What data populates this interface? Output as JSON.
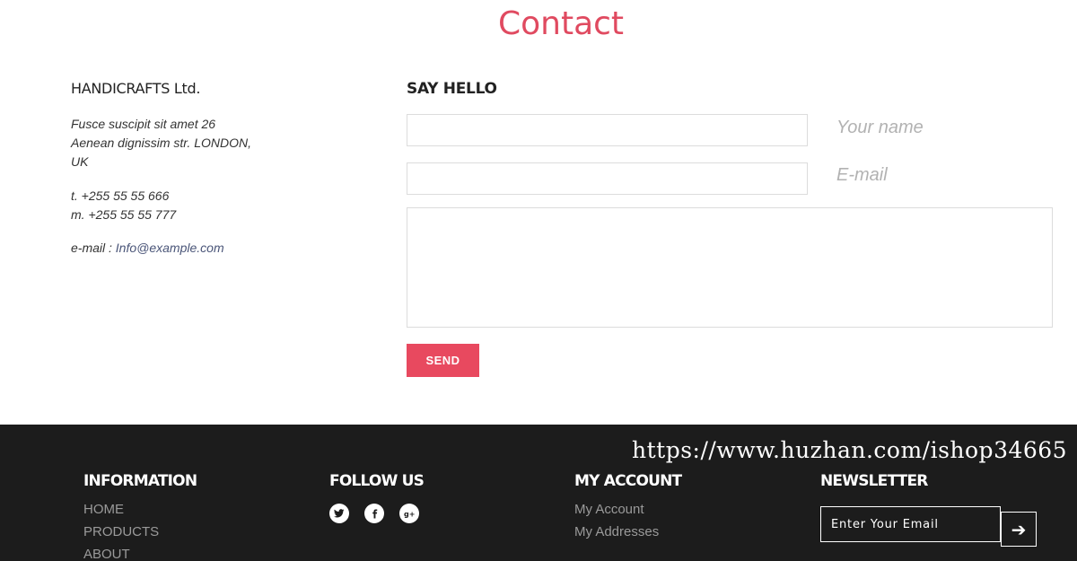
{
  "page_title": "Contact",
  "company": {
    "name": "HANDICRAFTS Ltd.",
    "address_line1": "Fusce suscipit sit amet 26",
    "address_line2": "Aenean dignissim str. LONDON,",
    "address_line3": "UK",
    "phone": "t. +255 55 55 666",
    "mobile": "m. +255 55 55 777",
    "email_label": "e-mail :",
    "email": "Info@example.com"
  },
  "form": {
    "heading": "SAY HELLO",
    "name_label": "Your name",
    "email_label": "E-mail",
    "name_value": "",
    "email_value": "",
    "message_value": "",
    "send_label": "SEND"
  },
  "footer": {
    "watermark": "https://www.huzhan.com/ishop34665",
    "information": {
      "heading": "INFORMATION",
      "links": [
        "HOME",
        "PRODUCTS",
        "ABOUT"
      ]
    },
    "follow": {
      "heading": "FOLLOW US",
      "icons": [
        "twitter-icon",
        "facebook-icon",
        "google-plus-icon"
      ]
    },
    "account": {
      "heading": "MY ACCOUNT",
      "links": [
        "My Account",
        "My Addresses"
      ]
    },
    "newsletter": {
      "heading": "NEWSLETTER",
      "placeholder": "Enter Your Email",
      "submit_icon": "arrow-right-icon"
    }
  },
  "colors": {
    "accent": "#e8495f",
    "title": "#e04a60",
    "footer_bg": "#1c1c1c"
  }
}
